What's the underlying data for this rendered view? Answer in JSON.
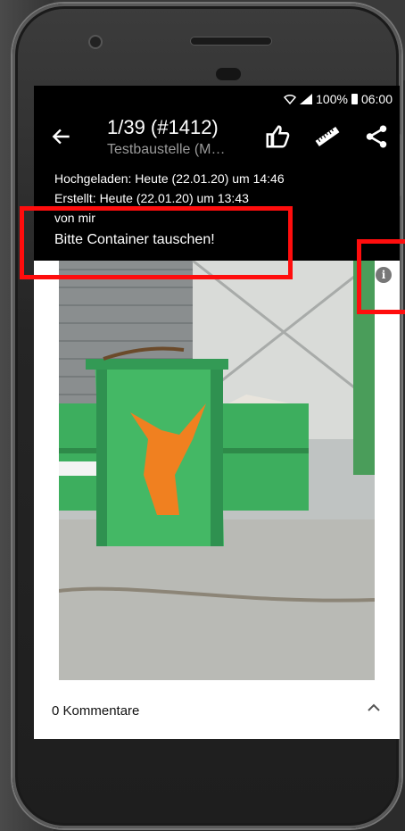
{
  "status_bar": {
    "battery": "100%",
    "time": "06:00"
  },
  "header": {
    "title": "1/39 (#1412)",
    "subtitle": "Testbaustelle (M…"
  },
  "meta": {
    "uploaded": "Hochgeladen: Heute (22.01.20) um 14:46",
    "created": "Erstellt: Heute (22.01.20) um 13:43",
    "author": "von mir"
  },
  "caption": "Bitte Container tauschen!",
  "info_glyph": "i",
  "comments": {
    "label": "0 Kommentare"
  },
  "icons": [
    "back-arrow-icon",
    "thumbs-up-icon",
    "ruler-icon",
    "share-icon",
    "info-icon",
    "chevron-up-icon"
  ],
  "colors": {
    "highlight": "#ff0d0d",
    "container_green": "#3dae5e",
    "logo_orange": "#f08020"
  }
}
